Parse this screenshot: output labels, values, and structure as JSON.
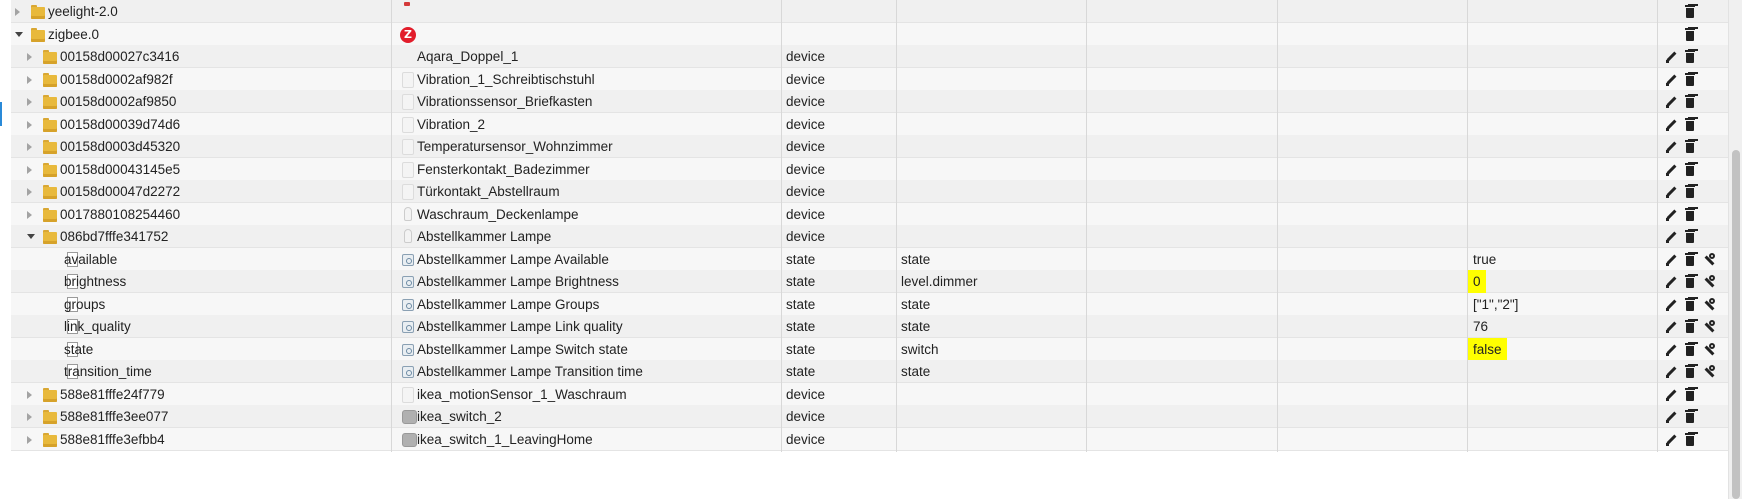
{
  "tree": {
    "rows": [
      {
        "indent": 0,
        "expander": "closed",
        "icon": "folder",
        "id": "yeelight-2.0",
        "dev_icon": "yee",
        "name": "",
        "type": "",
        "role": "",
        "room": "",
        "function": "",
        "value": "",
        "highlight": false,
        "buttons": [
          "delete"
        ]
      },
      {
        "indent": 0,
        "expander": "open",
        "icon": "folder",
        "id": "zigbee.0",
        "dev_icon": "zlogo",
        "name": "",
        "type": "",
        "role": "",
        "room": "",
        "function": "",
        "value": "",
        "highlight": false,
        "buttons": [
          "delete"
        ]
      },
      {
        "indent": 1,
        "expander": "closed",
        "icon": "folder",
        "id": "00158d00027c3416",
        "dev_icon": "none",
        "name": "Aqara_Doppel_1",
        "type": "device",
        "role": "",
        "room": "",
        "function": "",
        "value": "",
        "highlight": false,
        "buttons": [
          "edit",
          "delete"
        ]
      },
      {
        "indent": 1,
        "expander": "closed",
        "icon": "folder",
        "id": "00158d0002af982f",
        "dev_icon": "sensor",
        "name": "Vibration_1_Schreibtischstuhl",
        "type": "device",
        "role": "",
        "room": "",
        "function": "",
        "value": "",
        "highlight": false,
        "buttons": [
          "edit",
          "delete"
        ]
      },
      {
        "indent": 1,
        "expander": "closed",
        "icon": "folder",
        "id": "00158d0002af9850",
        "dev_icon": "sensor",
        "name": "Vibrationssensor_Briefkasten",
        "type": "device",
        "role": "",
        "room": "",
        "function": "",
        "value": "",
        "highlight": false,
        "buttons": [
          "edit",
          "delete"
        ]
      },
      {
        "indent": 1,
        "expander": "closed",
        "icon": "folder",
        "id": "00158d00039d74d6",
        "dev_icon": "sensor",
        "name": "Vibration_2",
        "type": "device",
        "role": "",
        "room": "",
        "function": "",
        "value": "",
        "highlight": false,
        "buttons": [
          "edit",
          "delete"
        ]
      },
      {
        "indent": 1,
        "expander": "closed",
        "icon": "folder",
        "id": "00158d0003d45320",
        "dev_icon": "sensor",
        "name": "Temperatursensor_Wohnzimmer",
        "type": "device",
        "role": "",
        "room": "",
        "function": "",
        "value": "",
        "highlight": false,
        "buttons": [
          "edit",
          "delete"
        ]
      },
      {
        "indent": 1,
        "expander": "closed",
        "icon": "folder",
        "id": "00158d00043145e5",
        "dev_icon": "sensor",
        "name": "Fensterkontakt_Badezimmer",
        "type": "device",
        "role": "",
        "room": "",
        "function": "",
        "value": "",
        "highlight": false,
        "buttons": [
          "edit",
          "delete"
        ]
      },
      {
        "indent": 1,
        "expander": "closed",
        "icon": "folder",
        "id": "00158d00047d2272",
        "dev_icon": "sensor",
        "name": "Türkontakt_Abstellraum",
        "type": "device",
        "role": "",
        "room": "",
        "function": "",
        "value": "",
        "highlight": false,
        "buttons": [
          "edit",
          "delete"
        ]
      },
      {
        "indent": 1,
        "expander": "closed",
        "icon": "folder",
        "id": "0017880108254460",
        "dev_icon": "bulb",
        "name": "Waschraum_Deckenlampe",
        "type": "device",
        "role": "",
        "room": "",
        "function": "",
        "value": "",
        "highlight": false,
        "buttons": [
          "edit",
          "delete"
        ]
      },
      {
        "indent": 1,
        "expander": "open",
        "icon": "folder",
        "id": "086bd7fffe341752",
        "dev_icon": "bulb",
        "name": "Abstellkammer Lampe",
        "type": "device",
        "role": "",
        "room": "",
        "function": "",
        "value": "",
        "highlight": false,
        "buttons": [
          "edit",
          "delete"
        ]
      },
      {
        "indent": 2,
        "expander": "none",
        "icon": "file",
        "id": "available",
        "dev_icon": "state",
        "name": "Abstellkammer Lampe Available",
        "type": "state",
        "role": "state",
        "room": "",
        "function": "",
        "value": "true",
        "highlight": false,
        "buttons": [
          "edit",
          "delete",
          "settings"
        ]
      },
      {
        "indent": 2,
        "expander": "none",
        "icon": "file",
        "id": "brightness",
        "dev_icon": "state",
        "name": "Abstellkammer Lampe Brightness",
        "type": "state",
        "role": "level.dimmer",
        "room": "",
        "function": "",
        "value": "0",
        "highlight": true,
        "buttons": [
          "edit",
          "delete",
          "settings"
        ]
      },
      {
        "indent": 2,
        "expander": "none",
        "icon": "file",
        "id": "groups",
        "dev_icon": "state",
        "name": "Abstellkammer Lampe Groups",
        "type": "state",
        "role": "state",
        "room": "",
        "function": "",
        "value": "[\"1\",\"2\"]",
        "highlight": false,
        "buttons": [
          "edit",
          "delete",
          "settings"
        ]
      },
      {
        "indent": 2,
        "expander": "none",
        "icon": "file",
        "id": "link_quality",
        "dev_icon": "state",
        "name": "Abstellkammer Lampe Link quality",
        "type": "state",
        "role": "state",
        "room": "",
        "function": "",
        "value": "76",
        "highlight": false,
        "buttons": [
          "edit",
          "delete",
          "settings"
        ]
      },
      {
        "indent": 2,
        "expander": "none",
        "icon": "file",
        "id": "state",
        "dev_icon": "state",
        "name": "Abstellkammer Lampe Switch state",
        "type": "state",
        "role": "switch",
        "room": "",
        "function": "",
        "value": "false",
        "highlight": true,
        "buttons": [
          "edit",
          "delete",
          "settings"
        ]
      },
      {
        "indent": 2,
        "expander": "none",
        "icon": "file",
        "id": "transition_time",
        "dev_icon": "state",
        "name": "Abstellkammer Lampe Transition time",
        "type": "state",
        "role": "state",
        "room": "",
        "function": "",
        "value": "",
        "highlight": false,
        "buttons": [
          "edit",
          "delete",
          "settings"
        ]
      },
      {
        "indent": 1,
        "expander": "closed",
        "icon": "folder",
        "id": "588e81fffe24f779",
        "dev_icon": "sensor",
        "name": "ikea_motionSensor_1_Waschraum",
        "type": "device",
        "role": "",
        "room": "",
        "function": "",
        "value": "",
        "highlight": false,
        "buttons": [
          "edit",
          "delete"
        ]
      },
      {
        "indent": 1,
        "expander": "closed",
        "icon": "folder",
        "id": "588e81fffe3ee077",
        "dev_icon": "roundgrey",
        "name": "ikea_switch_2",
        "type": "device",
        "role": "",
        "room": "",
        "function": "",
        "value": "",
        "highlight": false,
        "buttons": [
          "edit",
          "delete"
        ]
      },
      {
        "indent": 1,
        "expander": "closed",
        "icon": "folder",
        "id": "588e81fffe3efbb4",
        "dev_icon": "roundgrey",
        "name": "ikea_switch_1_LeavingHome",
        "type": "device",
        "role": "",
        "room": "",
        "function": "",
        "value": "",
        "highlight": false,
        "buttons": [
          "edit",
          "delete"
        ]
      }
    ]
  }
}
